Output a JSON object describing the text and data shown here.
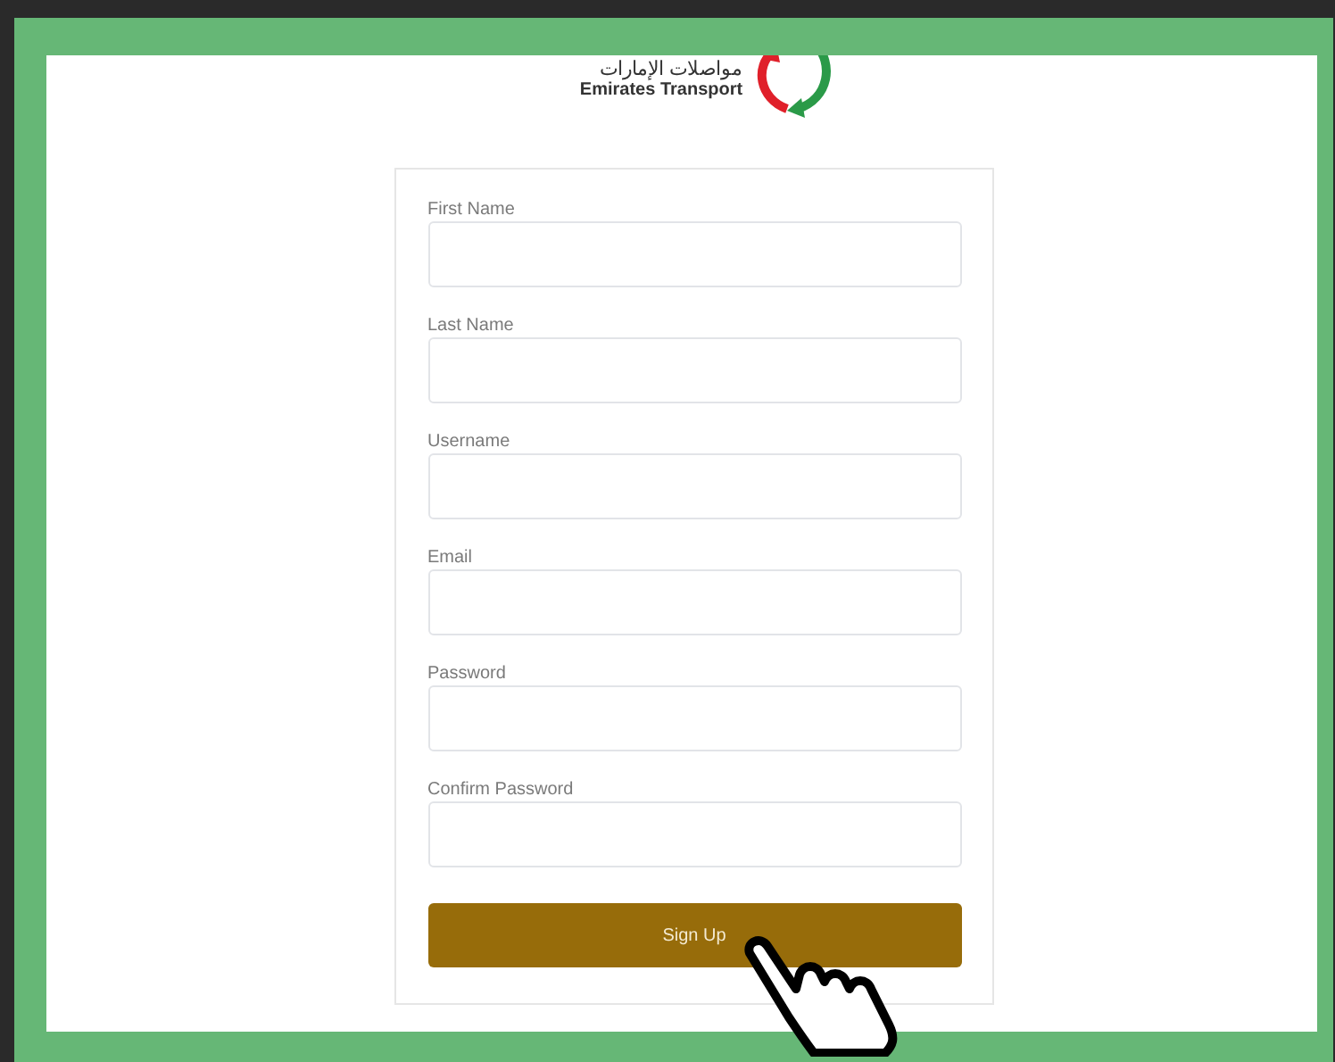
{
  "logo": {
    "arabic": "مواصلات الإمارات",
    "english": "Emirates Transport"
  },
  "fields": [
    {
      "label": "First Name"
    },
    {
      "label": "Last Name"
    },
    {
      "label": "Username"
    },
    {
      "label": "Email"
    },
    {
      "label": "Password"
    },
    {
      "label": "Confirm Password"
    }
  ],
  "button": "Sign Up"
}
